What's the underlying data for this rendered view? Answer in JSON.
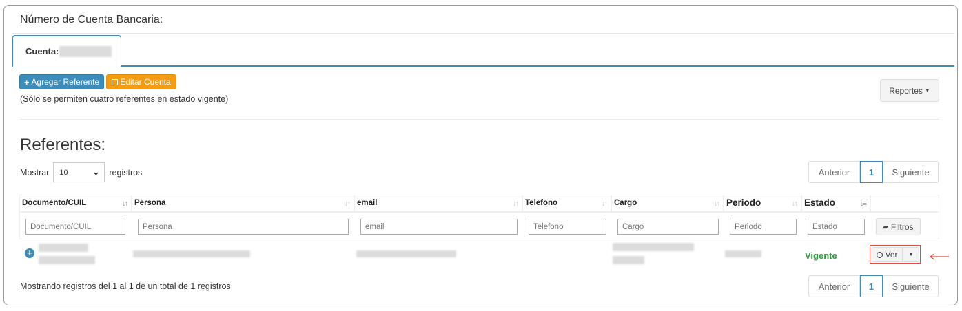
{
  "card": {
    "title": "Número de Cuenta Bancaria:"
  },
  "tab": {
    "label": "Cuenta:"
  },
  "toolbar": {
    "add_referente": "Agregar Referente",
    "edit_cuenta": "Editar Cuenta",
    "note": "(Sólo se permiten cuatro referentes en estado vigente)",
    "reportes": "Reportes"
  },
  "section": {
    "title": "Referentes:"
  },
  "length_control": {
    "prefix": "Mostrar",
    "value": "10",
    "suffix": "registros"
  },
  "pagination": {
    "prev": "Anterior",
    "current": "1",
    "next": "Siguiente"
  },
  "table": {
    "columns": [
      "Documento/CUIL",
      "Persona",
      "email",
      "Telefono",
      "Cargo",
      "Periodo",
      "Estado"
    ],
    "filters": [
      "Documento/CUIL",
      "Persona",
      "email",
      "Telefono",
      "Cargo",
      "Periodo",
      "Estado"
    ],
    "filters_button": "Filtros",
    "rows": [
      {
        "estado": "Vigente",
        "action": "Ver"
      }
    ]
  },
  "footer": {
    "info": "Mostrando registros del 1 al 1 de un total de 1 registros"
  },
  "colors": {
    "primary": "#3c8dbc",
    "warning": "#f39c12",
    "success": "#2e9d3b",
    "highlight": "#e74c3c"
  },
  "icons": {
    "add": "plus-icon",
    "edit": "edit-icon",
    "caret": "caret-down-icon",
    "search": "search-icon",
    "eraser": "eraser-icon",
    "expand": "plus-circle-icon",
    "pointer": "arrow-left-icon"
  }
}
